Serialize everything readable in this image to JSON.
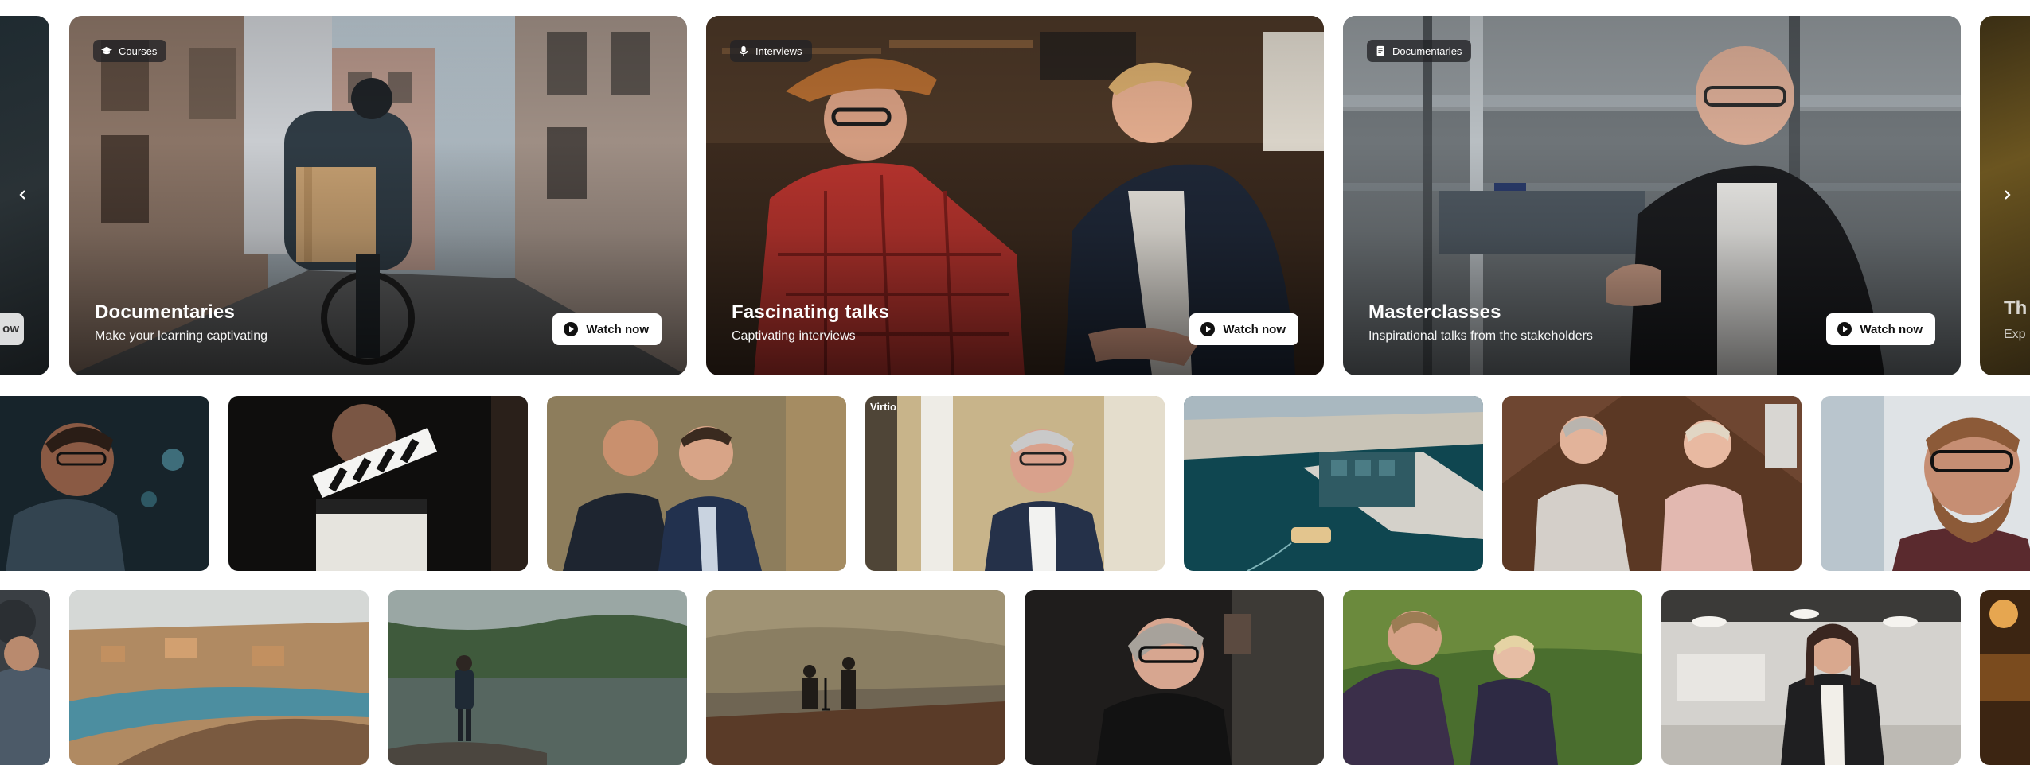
{
  "carousel": {
    "partial_left": {
      "button_label": "ow"
    },
    "partial_right": {
      "title": "Th",
      "subtitle": "Exp"
    },
    "cards": [
      {
        "badge_icon": "graduation-cap-icon",
        "badge": "Courses",
        "title": "Documentaries",
        "subtitle": "Make your learning captivating",
        "button": "Watch now"
      },
      {
        "badge_icon": "microphone-icon",
        "badge": "Interviews",
        "title": "Fascinating talks",
        "subtitle": "Captivating interviews",
        "button": "Watch now"
      },
      {
        "badge_icon": "document-icon",
        "badge": "Documentaries",
        "title": "Masterclasses",
        "subtitle": "Inspirational talks from the stakeholders",
        "button": "Watch now"
      }
    ],
    "prev_icon": "chevron-left-icon",
    "next_icon": "chevron-right-icon"
  },
  "thumbnails_row1": [
    {
      "subject": "man with glasses at night"
    },
    {
      "subject": "film clapperboard"
    },
    {
      "subject": "two men in suits talking outdoors"
    },
    {
      "subject": "man in suit speaking",
      "watermark": "Virtio"
    },
    {
      "subject": "aerial harbour with ferry"
    },
    {
      "subject": "two women seated in attic"
    },
    {
      "subject": "bearded man with glasses"
    }
  ],
  "thumbnails_row2": [
    {
      "subject": "person with camera"
    },
    {
      "subject": "aerial city canal"
    },
    {
      "subject": "person on lake shore"
    },
    {
      "subject": "film crew in fog"
    },
    {
      "subject": "woman with glasses"
    },
    {
      "subject": "woman with child in garden"
    },
    {
      "subject": "woman in office"
    },
    {
      "subject": "warm lit interior"
    }
  ],
  "colors": {
    "badge_bg": "#232326",
    "button_bg": "#ffffff",
    "button_text": "#111111"
  }
}
